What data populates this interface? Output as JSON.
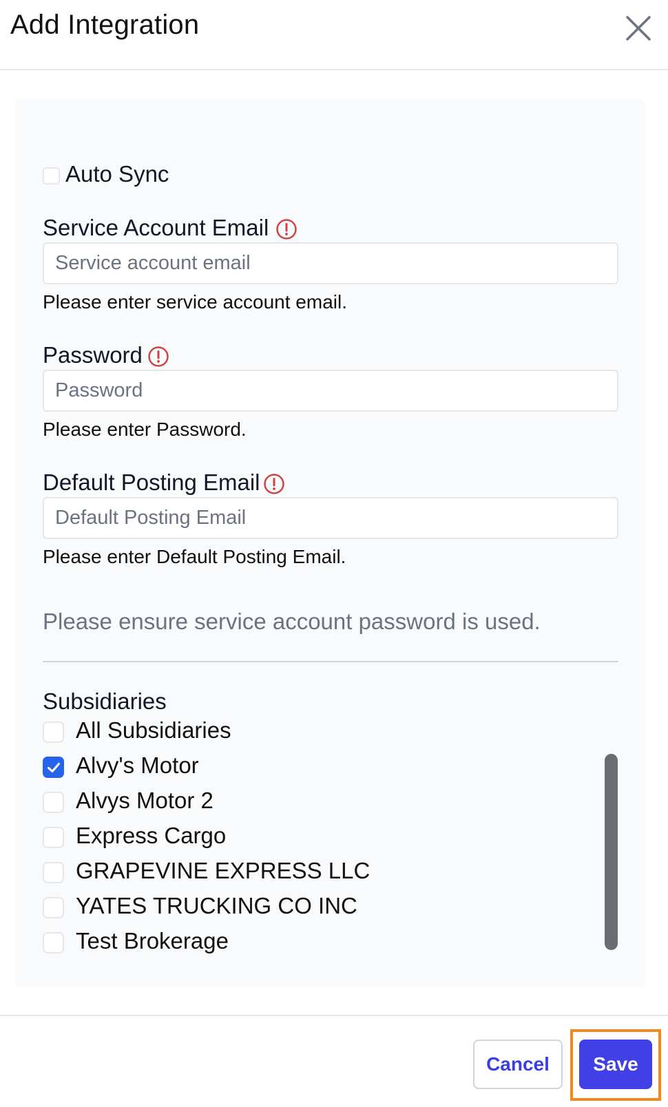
{
  "dialog": {
    "title": "Add Integration",
    "close_icon": "close-icon"
  },
  "form": {
    "auto_sync": {
      "label": "Auto Sync",
      "checked": false
    },
    "service_account_email": {
      "label": "Service Account Email",
      "placeholder": "Service account email",
      "value": "",
      "error": "Please enter service account email.",
      "icon": "alert-circle-icon"
    },
    "password": {
      "label": "Password",
      "placeholder": "Password",
      "value": "",
      "error": "Please enter Password.",
      "icon": "alert-circle-icon"
    },
    "default_posting_email": {
      "label": "Default Posting Email",
      "placeholder": "Default Posting Email",
      "value": "",
      "error": "Please enter Default Posting Email.",
      "icon": "alert-circle-icon"
    },
    "note": "Please ensure service account password is used."
  },
  "subsidiaries": {
    "title": "Subsidiaries",
    "items": [
      {
        "label": "All Subsidiaries",
        "checked": false
      },
      {
        "label": "Alvy's Motor",
        "checked": true
      },
      {
        "label": "Alvys Motor 2",
        "checked": false
      },
      {
        "label": "Express Cargo",
        "checked": false
      },
      {
        "label": "GRAPEVINE EXPRESS LLC",
        "checked": false
      },
      {
        "label": "YATES TRUCKING CO INC",
        "checked": false
      },
      {
        "label": "Test Brokerage",
        "checked": false
      }
    ]
  },
  "footer": {
    "cancel_label": "Cancel",
    "save_label": "Save"
  },
  "colors": {
    "accent": "#4040e6",
    "error": "#d14343",
    "highlight": "#f08a1e",
    "checkbox_checked": "#2563eb"
  }
}
